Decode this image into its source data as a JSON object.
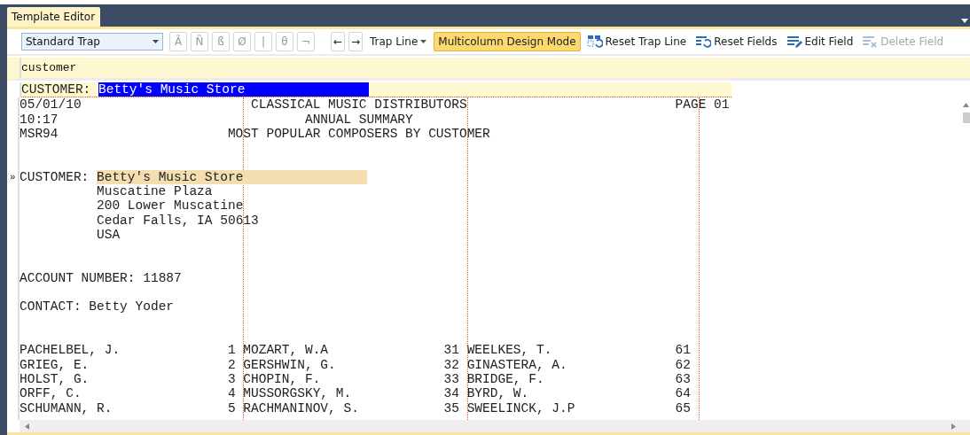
{
  "tabs": [
    {
      "label": "Template Editor",
      "selected": true
    }
  ],
  "toolbar": {
    "trap_type": "Standard Trap",
    "char_buttons": [
      "Ã",
      "Ñ",
      "ß",
      "Ø",
      "|",
      "θ",
      "¬"
    ],
    "nav_buttons": [
      "←",
      "→"
    ],
    "trap_line_menu": "Trap Line",
    "design_mode": {
      "label": "Multicolumn Design Mode",
      "on": true
    },
    "actions": [
      {
        "kind": "reset-line",
        "label": "Reset Trap Line",
        "disabled": false
      },
      {
        "kind": "reset-fields",
        "label": "Reset Fields",
        "disabled": false
      },
      {
        "kind": "edit",
        "label": "Edit Field",
        "disabled": false
      },
      {
        "kind": "delete",
        "label": "Delete Field",
        "disabled": true
      }
    ]
  },
  "search": {
    "value": "customer"
  },
  "trap_line": {
    "label": "CUSTOMER:",
    "value": "Betty's Music Store",
    "selected": true
  },
  "report": {
    "header": [
      {
        "left": "05/01/10",
        "title": "CLASSICAL MUSIC DISTRIBUTORS",
        "right": "PAGE 01"
      },
      {
        "left": "10:17",
        "title": "ANNUAL SUMMARY"
      },
      {
        "left": "MSR94",
        "title": "MOST POPULAR COMPOSERS BY CUSTOMER"
      }
    ],
    "customer": {
      "marker": "»",
      "label": "CUSTOMER:",
      "value": "Betty's Music Store",
      "matched": true,
      "address": [
        "Muscatine Plaza",
        "200 Lower Muscatine",
        "Cedar Falls, IA 50613",
        "USA"
      ]
    },
    "account": "ACCOUNT NUMBER: 11887",
    "contact": "CONTACT: Betty Yoder",
    "rows": [
      [
        {
          "name": "PACHELBEL, J.",
          "rank": "1"
        },
        {
          "name": "MOZART, W.A",
          "rank": "31"
        },
        {
          "name": "WEELKES, T.",
          "rank": "61"
        }
      ],
      [
        {
          "name": "GRIEG, E.",
          "rank": "2"
        },
        {
          "name": "GERSHWIN, G.",
          "rank": "32"
        },
        {
          "name": "GINASTERA, A.",
          "rank": "62"
        }
      ],
      [
        {
          "name": "HOLST, G.",
          "rank": "3"
        },
        {
          "name": "CHOPIN, F.",
          "rank": "33"
        },
        {
          "name": "BRIDGE, F.",
          "rank": "63"
        }
      ],
      [
        {
          "name": "ORFF, C.",
          "rank": "4"
        },
        {
          "name": "MUSSORGSKY, M.",
          "rank": "34"
        },
        {
          "name": "BYRD, W.",
          "rank": "64"
        }
      ],
      [
        {
          "name": "SCHUMANN, R.",
          "rank": "5"
        },
        {
          "name": "RACHMANINOV, S.",
          "rank": "35"
        },
        {
          "name": "SWEELINCK, J.P",
          "rank": "65"
        }
      ]
    ]
  }
}
